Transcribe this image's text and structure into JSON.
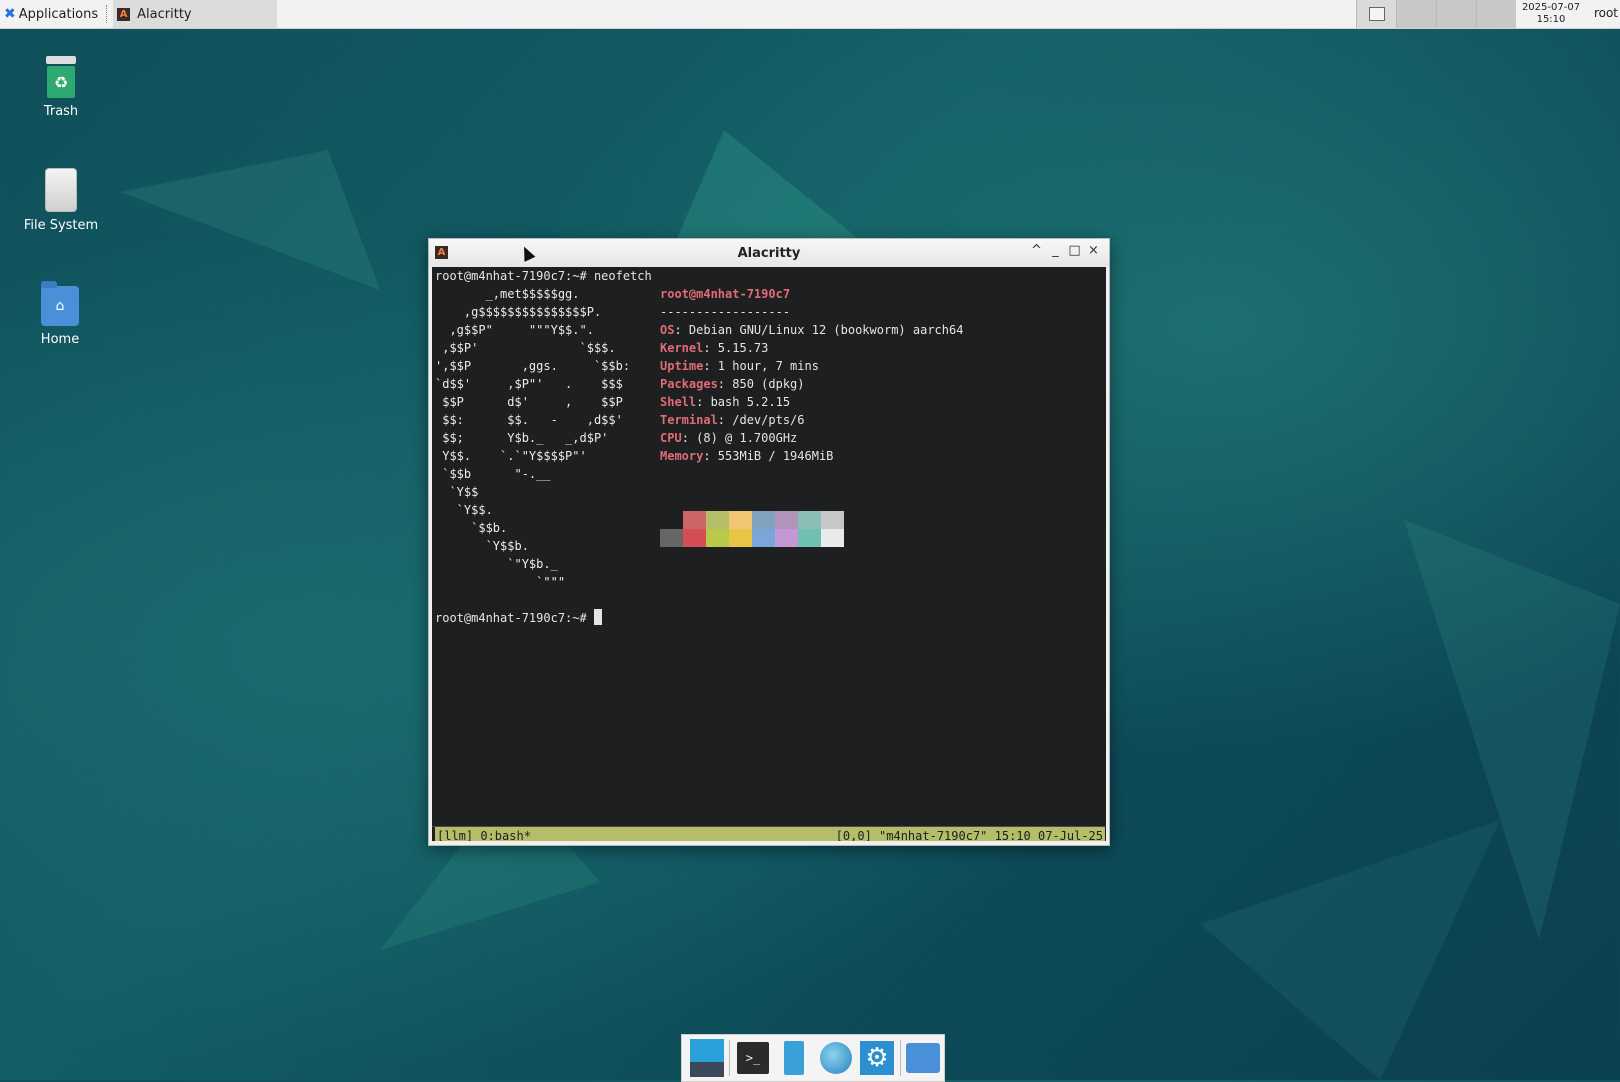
{
  "top_panel": {
    "applications_label": "Applications",
    "task_label": "Alacritty",
    "clock_date": "2025-07-07",
    "clock_time": "15:10",
    "user": "root"
  },
  "desktop_icons": [
    {
      "label": "Trash",
      "icon": "trash-icon"
    },
    {
      "label": "File System",
      "icon": "drive-icon"
    },
    {
      "label": "Home",
      "icon": "home-folder-icon"
    }
  ],
  "window": {
    "title": "Alacritty",
    "controls": [
      "^",
      "_",
      "□",
      "×"
    ]
  },
  "terminal": {
    "prompt1": "root@m4nhat-7190c7:~# neofetch",
    "hostline": "root@m4nhat-7190c7",
    "underline": "------------------",
    "info": [
      {
        "key": "OS",
        "value": "Debian GNU/Linux 12 (bookworm) aarch64"
      },
      {
        "key": "Kernel",
        "value": "5.15.73"
      },
      {
        "key": "Uptime",
        "value": "1 hour, 7 mins"
      },
      {
        "key": "Packages",
        "value": "850 (dpkg)"
      },
      {
        "key": "Shell",
        "value": "bash 5.2.15"
      },
      {
        "key": "Terminal",
        "value": "/dev/pts/6"
      },
      {
        "key": "CPU",
        "value": "(8) @ 1.700GHz"
      },
      {
        "key": "Memory",
        "value": "553MiB / 1946MiB"
      }
    ],
    "logo": [
      "       _,met$$$$$gg.",
      "    ,g$$$$$$$$$$$$$$$P.",
      "  ,g$$P\"     \"\"\"Y$$.\".",
      " ,$$P'              `$$$.",
      "',$$P       ,ggs.     `$$b:",
      "`d$$'     ,$P\"'   .    $$$",
      " $$P      d$'     ,    $$P",
      " $$:      $$.   -    ,d$$'",
      " $$;      Y$b._   _,d$P'",
      " Y$$.    `.`\"Y$$$$P\"'",
      " `$$b      \"-.__",
      "  `Y$$",
      "   `Y$$.",
      "     `$$b.",
      "       `Y$$b.",
      "          `\"Y$b._",
      "              `\"\"\""
    ],
    "prompt2": "root@m4nhat-7190c7:~# ",
    "palette_top": [
      "#1d1f21",
      "#cc6666",
      "#b5bd68",
      "#f0c674",
      "#81a2be",
      "#b294bb",
      "#8abeb7",
      "#c5c8c6"
    ],
    "palette_bottom": [
      "#666666",
      "#d54e53",
      "#b9ca4a",
      "#e7c547",
      "#7aa6da",
      "#c397d8",
      "#70c0b1",
      "#eaeaea"
    ],
    "tmux_left": "[llm] 0:bash*",
    "tmux_right": "[0,0] \"m4nhat-7190c7\" 15:10 07-Jul-25",
    "tmux_color": "#b5bd68"
  },
  "dock": [
    {
      "icon": "show-desktop-icon"
    },
    {
      "icon": "terminal-icon"
    },
    {
      "icon": "file-manager-icon"
    },
    {
      "icon": "web-browser-icon"
    },
    {
      "icon": "settings-icon"
    },
    {
      "icon": "folder-icon"
    }
  ]
}
